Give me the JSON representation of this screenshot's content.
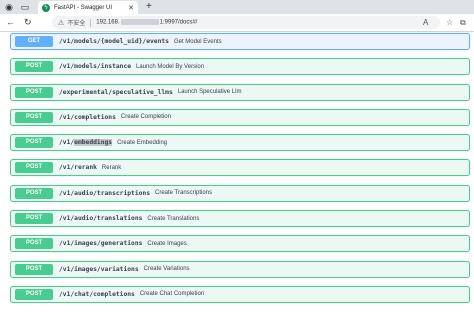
{
  "browser": {
    "tab_title": "FastAPI - Swagger UI",
    "security_label": "不安全",
    "url_prefix": "192.168.",
    "url_suffix": "1:9997/docs#/"
  },
  "operations": [
    {
      "method": "GET",
      "path_pre": "/v1/models/{model_uid}/events",
      "path_hl": "",
      "path_post": "",
      "summary": "Get Model Events"
    },
    {
      "method": "POST",
      "path_pre": "/v1/models/instance",
      "path_hl": "",
      "path_post": "",
      "summary": "Launch Model By Version"
    },
    {
      "method": "POST",
      "path_pre": "/experimental/speculative_llms",
      "path_hl": "",
      "path_post": "",
      "summary": "Launch Speculative Llm"
    },
    {
      "method": "POST",
      "path_pre": "/v1/completions",
      "path_hl": "",
      "path_post": "",
      "summary": "Create Completion"
    },
    {
      "method": "POST",
      "path_pre": "/v1/",
      "path_hl": "embeddings",
      "path_post": "",
      "summary": "Create Embedding"
    },
    {
      "method": "POST",
      "path_pre": "/v1/rerank",
      "path_hl": "",
      "path_post": "",
      "summary": "Rerank"
    },
    {
      "method": "POST",
      "path_pre": "/v1/audio/transcriptions",
      "path_hl": "",
      "path_post": "",
      "summary": "Create Transcriptions"
    },
    {
      "method": "POST",
      "path_pre": "/v1/audio/translations",
      "path_hl": "",
      "path_post": "",
      "summary": "Create Translations"
    },
    {
      "method": "POST",
      "path_pre": "/v1/images/generations",
      "path_hl": "",
      "path_post": "",
      "summary": "Create Images"
    },
    {
      "method": "POST",
      "path_pre": "/v1/images/variations",
      "path_hl": "",
      "path_post": "",
      "summary": "Create Variations"
    },
    {
      "method": "POST",
      "path_pre": "/v1/chat/completions",
      "path_hl": "",
      "path_post": "",
      "summary": "Create Chat Completion"
    }
  ]
}
